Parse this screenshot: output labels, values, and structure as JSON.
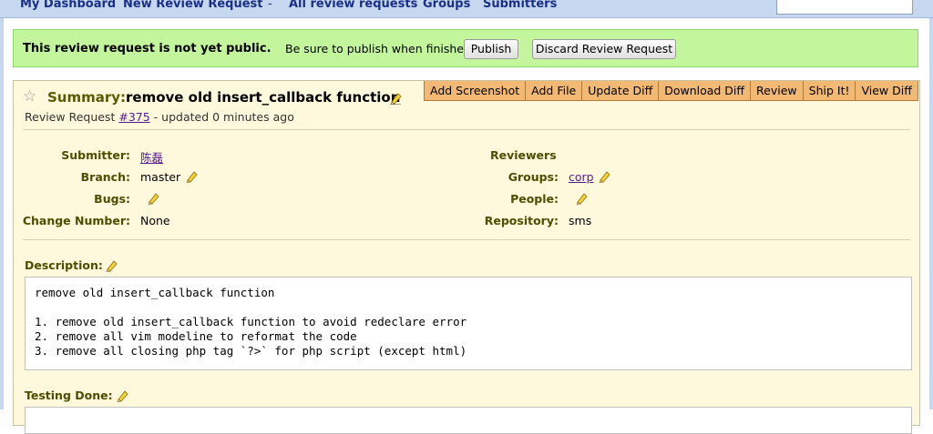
{
  "nav": {
    "items": [
      "My Dashboard",
      "New Review Request",
      "All review requests",
      "Groups",
      "Submitters"
    ],
    "separator": "-"
  },
  "banner": {
    "message": "This review request is not yet public.",
    "hint": "Be sure to publish when finished.",
    "publish": "Publish",
    "discard": "Discard Review Request"
  },
  "review": {
    "summary_label": "Summary:",
    "summary": "remove old insert_callback function",
    "request_prefix": "Review Request",
    "request_id": "#375",
    "updated": "- updated 0 minutes ago",
    "actions": [
      "Add Screenshot",
      "Add File",
      "Update Diff",
      "Download Diff",
      "Review",
      "Ship It!",
      "View Diff"
    ],
    "fields": {
      "submitter_label": "Submitter:",
      "submitter": "陈磊",
      "branch_label": "Branch:",
      "branch": "master",
      "bugs_label": "Bugs:",
      "change_label": "Change Number:",
      "change": "None",
      "reviewers_label": "Reviewers",
      "groups_label": "Groups:",
      "groups": "corp",
      "people_label": "People:",
      "repository_label": "Repository:",
      "repository": "sms"
    },
    "description_label": "Description:",
    "description": "remove old insert_callback function\n\n1. remove old insert_callback function to avoid redeclare error\n2. remove all vim modeline to reformat the code\n3. remove all closing php tag `?>` for php script (except html)",
    "testing_label": "Testing Done:"
  },
  "icons": {
    "star": "star-icon",
    "edit": "pencil-icon"
  },
  "colors": {
    "banner_bg": "#c3f59c",
    "review_bg": "#fef8dd",
    "action_bg": "#f2b975",
    "nav_bg": "#c5d8ef",
    "nav_text": "#1a2f87"
  }
}
